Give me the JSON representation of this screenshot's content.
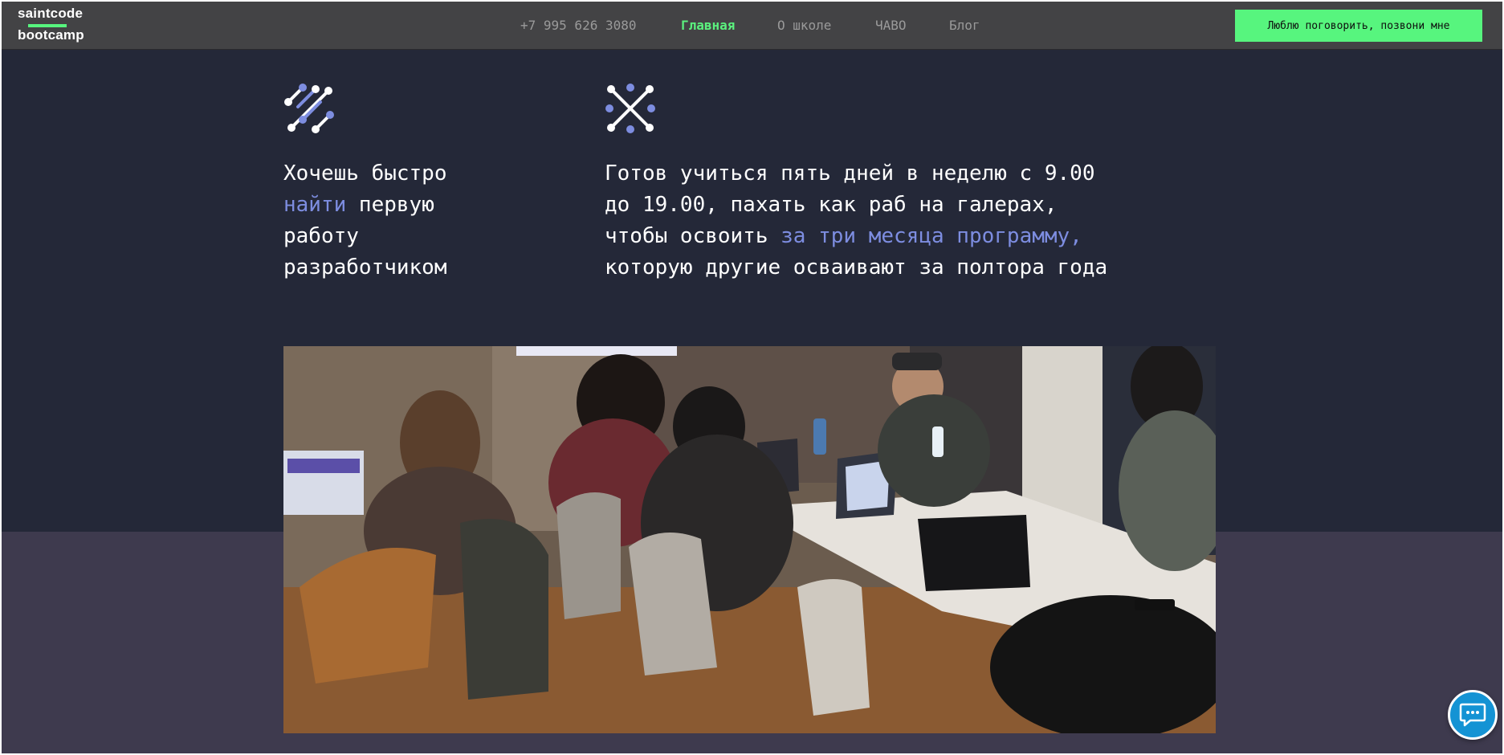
{
  "header": {
    "logo": {
      "line1": "saintcode",
      "line2": "bootcamp"
    },
    "nav": {
      "phone": "+7 995 626 3080",
      "home": "Главная",
      "about": "О школе",
      "faq": "ЧАВО",
      "blog": "Блог"
    },
    "cta_label": "Люблю поговорить, позвони мне"
  },
  "features": [
    {
      "icon": "molecule-diagonal-icon",
      "lines": [
        {
          "parts": [
            {
              "text": "Хочешь быстро",
              "highlight": false
            }
          ]
        },
        {
          "parts": [
            {
              "text": "найти",
              "highlight": true
            },
            {
              "text": " первую",
              "highlight": false
            }
          ]
        },
        {
          "parts": [
            {
              "text": "работу",
              "highlight": false
            }
          ]
        },
        {
          "parts": [
            {
              "text": "разработчиком",
              "highlight": false
            }
          ]
        }
      ]
    },
    {
      "icon": "molecule-cross-icon",
      "lines": [
        {
          "parts": [
            {
              "text": "Готов учиться пять дней в неделю с 9.00",
              "highlight": false
            }
          ]
        },
        {
          "parts": [
            {
              "text": "до 19.00, пахать как раб на галерах,",
              "highlight": false
            }
          ]
        },
        {
          "parts": [
            {
              "text": "чтобы освоить ",
              "highlight": false
            },
            {
              "text": "за три месяца программу,",
              "highlight": true
            }
          ]
        },
        {
          "parts": [
            {
              "text": "которую другие осваивают за полтора года",
              "highlight": false
            }
          ]
        }
      ]
    }
  ],
  "photo": {
    "subject": "classroom-photo"
  },
  "chat": {
    "icon": "chat-bubble-icon"
  },
  "colors": {
    "accent_green": "#57f57e",
    "highlight_blue": "#7d8de0",
    "bg_dark": "#242838",
    "bg_purple": "#3e3a4e",
    "header_bg": "#434345",
    "chat_blue": "#1493d4"
  }
}
